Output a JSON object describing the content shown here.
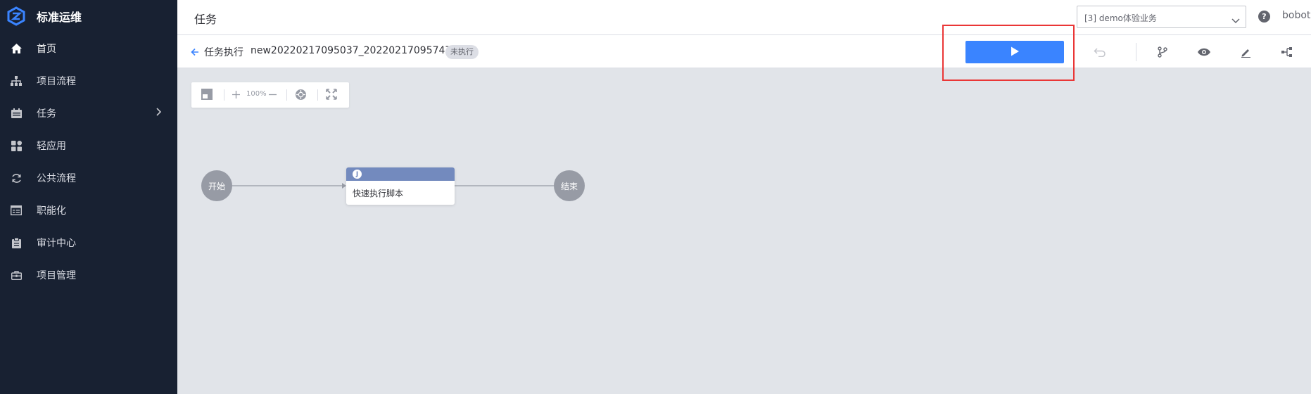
{
  "app": {
    "name": "标准运维"
  },
  "sidebar": {
    "items": [
      {
        "label": "首页",
        "icon": "home-icon"
      },
      {
        "label": "项目流程",
        "icon": "sitemap-icon"
      },
      {
        "label": "任务",
        "icon": "calendar-icon",
        "has_submenu": true
      },
      {
        "label": "轻应用",
        "icon": "apps-icon"
      },
      {
        "label": "公共流程",
        "icon": "cycle-icon"
      },
      {
        "label": "职能化",
        "icon": "browser-list-icon"
      },
      {
        "label": "审计中心",
        "icon": "clipboard-icon"
      },
      {
        "label": "项目管理",
        "icon": "briefcase-icon"
      }
    ]
  },
  "header": {
    "title": "任务",
    "business_select": {
      "value": "[3] demo体验业务"
    },
    "help_label": "?",
    "user": "bobot"
  },
  "taskbar": {
    "breadcrumb": "任务执行",
    "task_name": "new20220217095037_20220217095747",
    "status": "未执行"
  },
  "canvas_toolbar": {
    "zoom": "100%"
  },
  "flow": {
    "start_label": "开始",
    "end_label": "结束",
    "task_icon_label": "J",
    "task_label": "快速执行脚本"
  },
  "colors": {
    "sidebar_bg": "#182132",
    "accent": "#3a84ff",
    "highlight": "#ea3636",
    "node_gray": "#979ba5",
    "task_header": "#738abe",
    "canvas_bg": "#e1e4e9"
  }
}
